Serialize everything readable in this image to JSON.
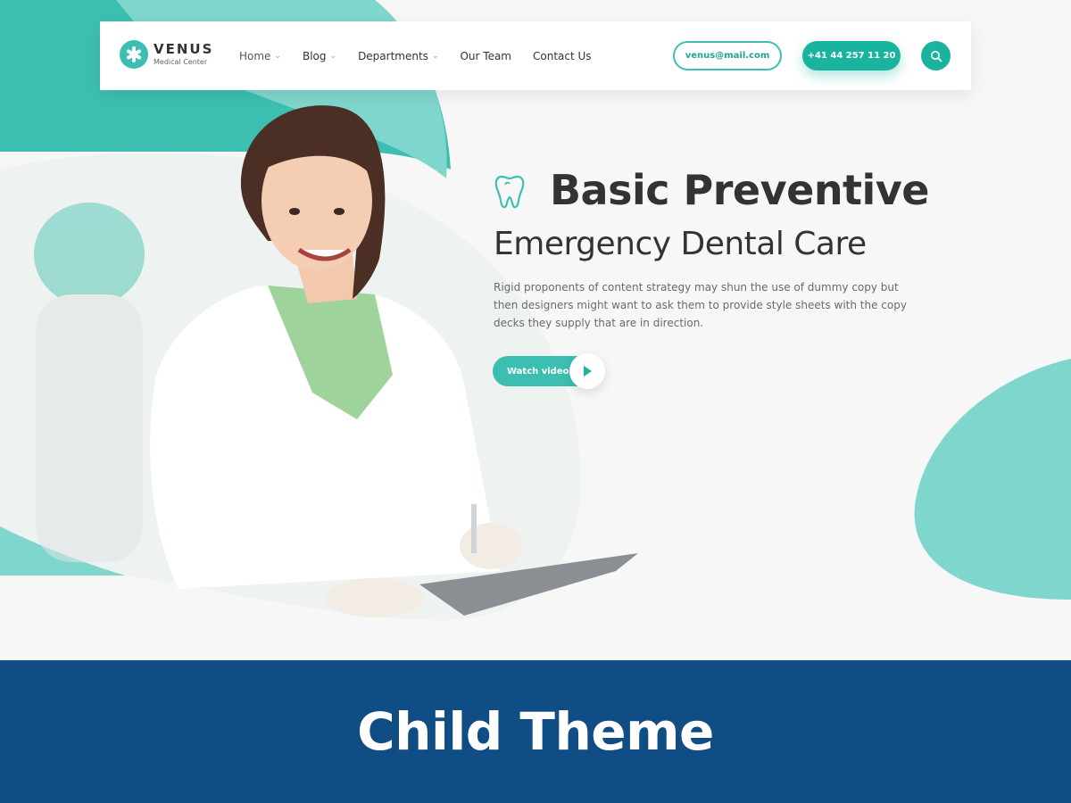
{
  "colors": {
    "accent": "#3cbfb1",
    "accent_dark": "#19b39f",
    "accent_light": "#7fd6cc",
    "banner_bg": "#104d84",
    "heading": "#333333",
    "body_text": "#6a6a6a"
  },
  "brand": {
    "name": "VENUS",
    "tagline": "Medical Center",
    "logo_icon": "asterisk-cross-icon"
  },
  "nav": {
    "items": [
      {
        "label": "Home",
        "has_dropdown": true
      },
      {
        "label": "Blog",
        "has_dropdown": true
      },
      {
        "label": "Departments",
        "has_dropdown": true
      },
      {
        "label": "Our Team",
        "has_dropdown": false
      },
      {
        "label": "Contact Us",
        "has_dropdown": false
      }
    ]
  },
  "header_actions": {
    "email": "venus@mail.com",
    "phone": "+41 44 257 11 20",
    "search_icon": "search-icon"
  },
  "hero": {
    "icon": "tooth-icon",
    "title": "Basic Preventive",
    "subtitle": "Emergency Dental Care",
    "description": "Rigid proponents of content strategy may shun the use of dummy copy but then designers might want to ask them to provide style sheets with the copy decks they supply that are in direction.",
    "video_button": "Watch video",
    "play_icon": "play-icon"
  },
  "banner": {
    "title": "Child Theme"
  }
}
